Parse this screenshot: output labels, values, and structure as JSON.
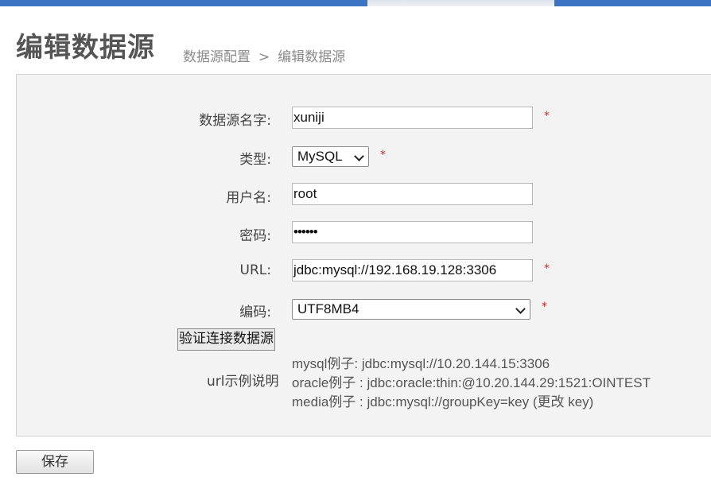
{
  "header": {
    "title": "编辑数据源",
    "breadcrumb": {
      "parent": "数据源配置",
      "separator": ">",
      "current": "编辑数据源"
    }
  },
  "form": {
    "name": {
      "label": "数据源名字:",
      "value": "xuniji",
      "required": "*"
    },
    "type": {
      "label": "类型:",
      "value": "MySQL",
      "required": "*"
    },
    "username": {
      "label": "用户名:",
      "value": "root"
    },
    "password": {
      "label": "密码:",
      "value": "••••••"
    },
    "url": {
      "label": "URL:",
      "value": "jdbc:mysql://192.168.19.128:3306",
      "required": "*"
    },
    "encoding": {
      "label": "编码:",
      "value": "UTF8MB4",
      "required": "*"
    },
    "verify_button": "验证连接数据源",
    "examples": {
      "label": "url示例说明",
      "lines": [
        "mysql例子: jdbc:mysql://10.20.144.15:3306",
        "oracle例子 : jdbc:oracle:thin:@10.20.144.29:1521:OINTEST",
        "media例子 : jdbc:mysql://groupKey=key (更改 key)"
      ]
    }
  },
  "footer": {
    "save_button": "保存"
  },
  "colors": {
    "accent": "#3a74c2",
    "required": "#e02020",
    "panel": "#f3f3f3"
  }
}
